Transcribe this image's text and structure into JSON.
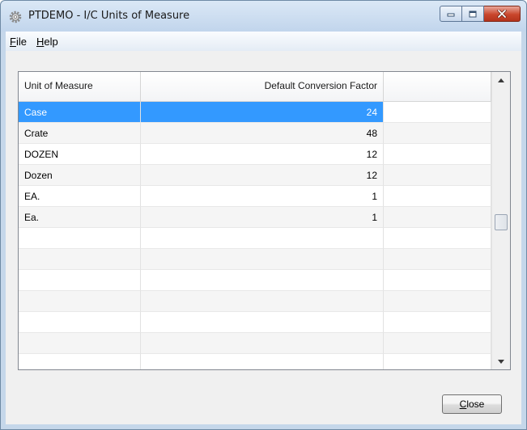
{
  "window": {
    "title": "PTDEMO - I/C Units of Measure"
  },
  "menu": {
    "items": [
      {
        "mnemonic": "F",
        "rest": "ile"
      },
      {
        "mnemonic": "H",
        "rest": "elp"
      }
    ]
  },
  "grid": {
    "columns": [
      "Unit of Measure",
      "Default Conversion Factor",
      ""
    ],
    "rows": [
      {
        "unit": "Case",
        "factor": "24",
        "selected": true
      },
      {
        "unit": "Crate",
        "factor": "48"
      },
      {
        "unit": "DOZEN",
        "factor": "12"
      },
      {
        "unit": "Dozen",
        "factor": "12"
      },
      {
        "unit": "EA.",
        "factor": "1"
      },
      {
        "unit": "Ea.",
        "factor": "1"
      },
      {
        "unit": "",
        "factor": ""
      },
      {
        "unit": "",
        "factor": ""
      },
      {
        "unit": "",
        "factor": ""
      },
      {
        "unit": "",
        "factor": ""
      },
      {
        "unit": "",
        "factor": ""
      },
      {
        "unit": "",
        "factor": ""
      },
      {
        "unit": "",
        "factor": ""
      }
    ]
  },
  "buttons": {
    "close": {
      "mnemonic": "C",
      "rest": "lose"
    }
  },
  "icons": {
    "app": "gear-icon",
    "minimize": "minimize-icon",
    "maximize": "maximize-icon",
    "close": "close-icon",
    "scroll_up": "chevron-up-icon",
    "scroll_down": "chevron-down-icon"
  },
  "colors": {
    "selection": "#3399ff",
    "window_frame": "#c5d7ea",
    "close_button": "#c9462c"
  }
}
